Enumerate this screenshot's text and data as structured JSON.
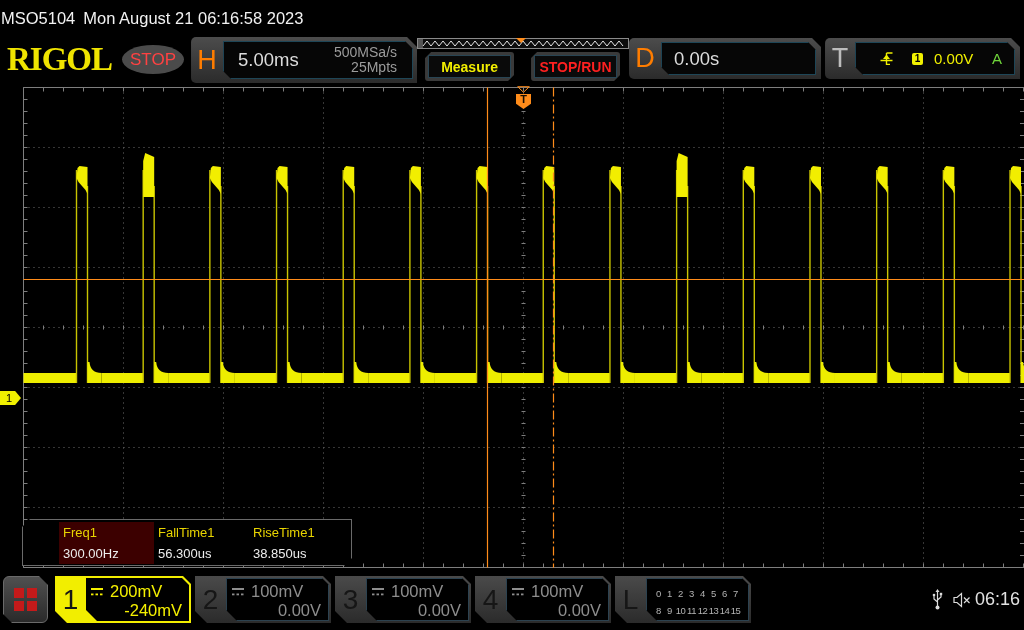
{
  "status_line": {
    "model": "MSO5104",
    "date_time": "Mon August 21 06:16:58 2023"
  },
  "header": {
    "logo": "RIGOL",
    "run_status": "STOP",
    "horizontal": {
      "label": "H",
      "time_scale": "5.00ms",
      "sample_rate": "500MSa/s",
      "memory_depth": "25Mpts"
    },
    "buttons": [
      {
        "label": "Measure",
        "kind": "measure"
      },
      {
        "label": "STOP/RUN",
        "kind": "run_stop"
      }
    ],
    "delay": {
      "label": "D",
      "value": "0.00s"
    },
    "trigger": {
      "label": "T",
      "source": "1",
      "level": "0.00V",
      "mode": "A"
    }
  },
  "display": {
    "trigger_marker": "T",
    "channel_marker": "1"
  },
  "measurements": [
    {
      "name": "Freq1",
      "value": "300.00Hz",
      "selected": true
    },
    {
      "name": "FallTime1",
      "value": "56.300us",
      "selected": false
    },
    {
      "name": "RiseTime1",
      "value": "38.850us",
      "selected": false
    }
  ],
  "channels": [
    {
      "number": "1",
      "scale": "200mV",
      "offset": "-240mV",
      "on": true
    },
    {
      "number": "2",
      "scale": "100mV",
      "offset": "0.00V",
      "on": false
    },
    {
      "number": "3",
      "scale": "100mV",
      "offset": "0.00V",
      "on": false
    },
    {
      "number": "4",
      "scale": "100mV",
      "offset": "0.00V",
      "on": false
    }
  ],
  "logic": {
    "label": "L",
    "bit_rows": [
      [
        "0",
        "1",
        "2",
        "3",
        "4",
        "5",
        "6",
        "7"
      ],
      [
        "8",
        "9",
        "10",
        "11",
        "12",
        "13",
        "14",
        "15"
      ]
    ]
  },
  "status_area": {
    "time": "06:16"
  }
}
